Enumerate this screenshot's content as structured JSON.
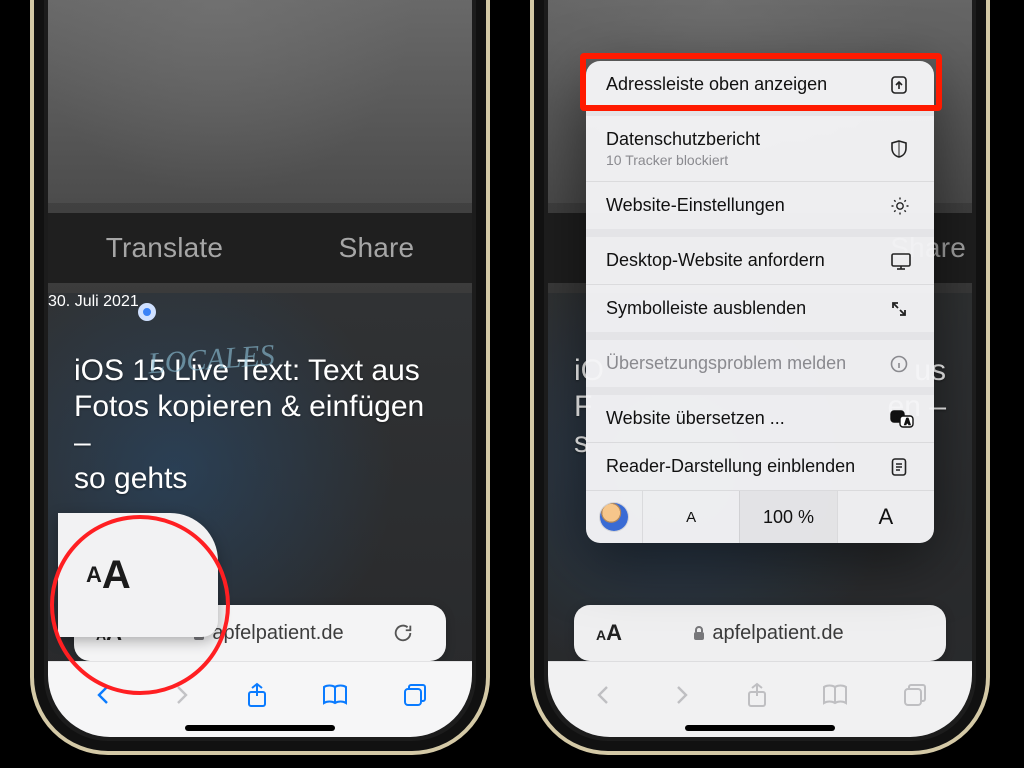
{
  "left": {
    "band": {
      "translate": "Translate",
      "share": "Share"
    },
    "article": {
      "title_l1": "iOS 15 Live Text: Text aus",
      "title_l2": "Fotos kopieren & einfügen –",
      "title_l3": "so gehts",
      "date": "30. Juli 2021",
      "chalk": "LOCALES"
    },
    "addrbar": {
      "domain": "apfelpatient.de"
    }
  },
  "right": {
    "band": {
      "share": "Share"
    },
    "article": {
      "title_l1": "iO",
      "title_l2": "F",
      "title_l3": "s",
      "title_tail1": "us",
      "title_tail2": "en –"
    },
    "menu": {
      "address_top": "Adressleiste oben anzeigen",
      "privacy": "Datenschutzbericht",
      "privacy_sub": "10 Tracker blockiert",
      "site_settings": "Website-Einstellungen",
      "request_desktop": "Desktop-Website anfordern",
      "hide_toolbar": "Symbolleiste ausblenden",
      "report_translation": "Übersetzungsproblem melden",
      "translate_site": "Website übersetzen ...",
      "show_reader": "Reader-Darstellung einblenden",
      "zoom_value": "100 %",
      "zoom_small": "A",
      "zoom_big": "A"
    },
    "addrbar": {
      "domain": "apfelpatient.de"
    }
  }
}
